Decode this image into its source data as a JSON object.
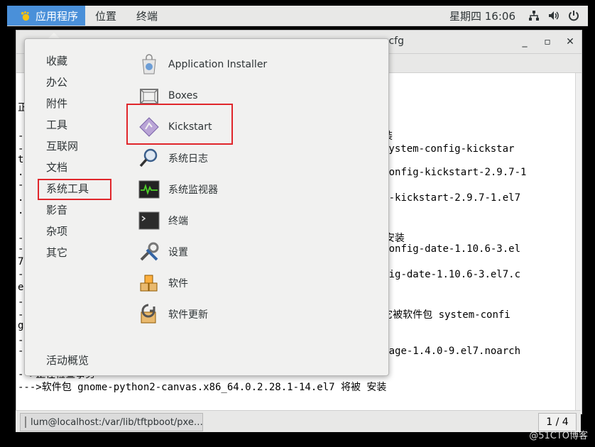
{
  "top_bar": {
    "apps_label": "应用程序",
    "places_label": "位置",
    "terminal_label": "终端",
    "clock": "星期四 16:06"
  },
  "terminal": {
    "title": ".cfg",
    "lines": [
      {
        "text": "正"
      },
      {
        "text": "-                                                      件被 安装"
      },
      {
        "text": "-                                                      软件包 system-config-kickstar"
      },
      {
        "text": "t"
      },
      {
        "text": ".                                                       stem-config-kickstart-2.9.7-1"
      },
      {
        "text": "-"
      },
      {
        "text": ".                                                       config-kickstart-2.9.7-1.el7"
      },
      {
        "text": "."
      },
      {
        "text": "-                                                      s 将被 安装"
      },
      {
        "text": "-                                                      ystem-config-date-1.10.6-3.el"
      },
      {
        "text": "7"
      },
      {
        "text": "-                                                      em-config-date-1.10.6-3.el7.c"
      },
      {
        "text": "e"
      },
      {
        "text": "-                                                      被 安装"
      },
      {
        "text": "-                                                      .el7, 它被软件包 system-confi"
      },
      {
        "text": "g"
      },
      {
        "text": "-                                                      被 安装"
      },
      {
        "text": "-                                                      g-language-1.4.0-9.el7.noarch"
      },
      {
        "text": "-->正在检查事务"
      },
      {
        "text": "--->软件包 gnome-python2-canvas.x86_64.0.2.28.1-14.el7 将被 安装"
      }
    ]
  },
  "menu": {
    "categories": [
      "收藏",
      "办公",
      "附件",
      "工具",
      "互联网",
      "文档",
      "系统工具",
      "影音",
      "杂项",
      "其它"
    ],
    "overview": "活动概览",
    "apps": [
      {
        "label": "Application Installer",
        "icon": "installer-icon"
      },
      {
        "label": "Boxes",
        "icon": "boxes-icon"
      },
      {
        "label": "Kickstart",
        "icon": "kickstart-icon"
      },
      {
        "label": "系统日志",
        "icon": "log-icon"
      },
      {
        "label": "系统监视器",
        "icon": "monitor-icon"
      },
      {
        "label": "终端",
        "icon": "terminal-icon"
      },
      {
        "label": "设置",
        "icon": "settings-icon"
      },
      {
        "label": "软件",
        "icon": "software-icon"
      },
      {
        "label": "软件更新",
        "icon": "update-icon"
      }
    ]
  },
  "taskbar": {
    "task_label": "lum@localhost:/var/lib/tftpboot/pxe…",
    "pager": "1 / 4"
  },
  "watermark": "@51CTO博客"
}
